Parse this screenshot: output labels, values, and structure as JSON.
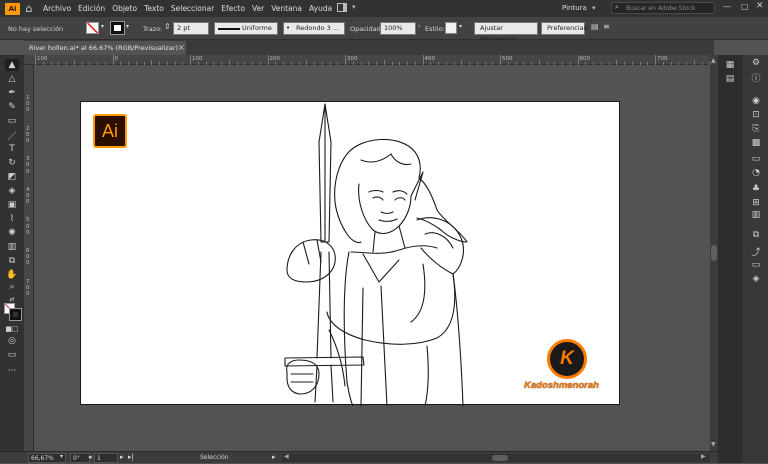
{
  "app": {
    "logo": "Ai"
  },
  "menu": {
    "items": [
      "Archivo",
      "Edición",
      "Objeto",
      "Texto",
      "Seleccionar",
      "Efecto",
      "Ver",
      "Ventana",
      "Ayuda"
    ]
  },
  "workspace": {
    "name": "Pintura",
    "search_placeholder": "Buscar en Adobe Stock"
  },
  "control": {
    "selection_status": "No hay selección",
    "stroke_label": "Trazo:",
    "stroke_weight": "2 pt",
    "profile": "Uniforme",
    "brush": "Redondo 3 ...",
    "opacity_label": "Opacidad:",
    "opacity": "100%",
    "style_label": "Estilo:",
    "fit_button": "Ajustar documento",
    "prefs_button": "Preferencias"
  },
  "document": {
    "tab_title": "River hollen.ai* al 66,67% (RGB/Previsualizar)"
  },
  "ruler": {
    "h_labels": [
      "100",
      "0",
      "100",
      "200",
      "300",
      "400",
      "500",
      "600",
      "700",
      "800",
      "900",
      "1000",
      "1100",
      "1200",
      "1300",
      "1400"
    ],
    "v_labels": [
      "1",
      "0",
      "0",
      "2",
      "0",
      "0",
      "3",
      "0",
      "0",
      "4",
      "0",
      "0",
      "5",
      "0",
      "0",
      "6",
      "0",
      "0",
      "7",
      "0",
      "0"
    ]
  },
  "artwork": {
    "badge_text": "Ai",
    "watermark_letter": "K",
    "watermark_text": "Kadoshmenorah"
  },
  "status": {
    "zoom": "66,67%",
    "rotation": "0°",
    "artboard_num": "1",
    "tool_mode": "Selección"
  },
  "colors": {
    "accent": "#ff9a00",
    "badge_bg": "#2a0f00",
    "watermark_orange": "#ff7a00",
    "watermark_bg": "#1a1a1a"
  }
}
